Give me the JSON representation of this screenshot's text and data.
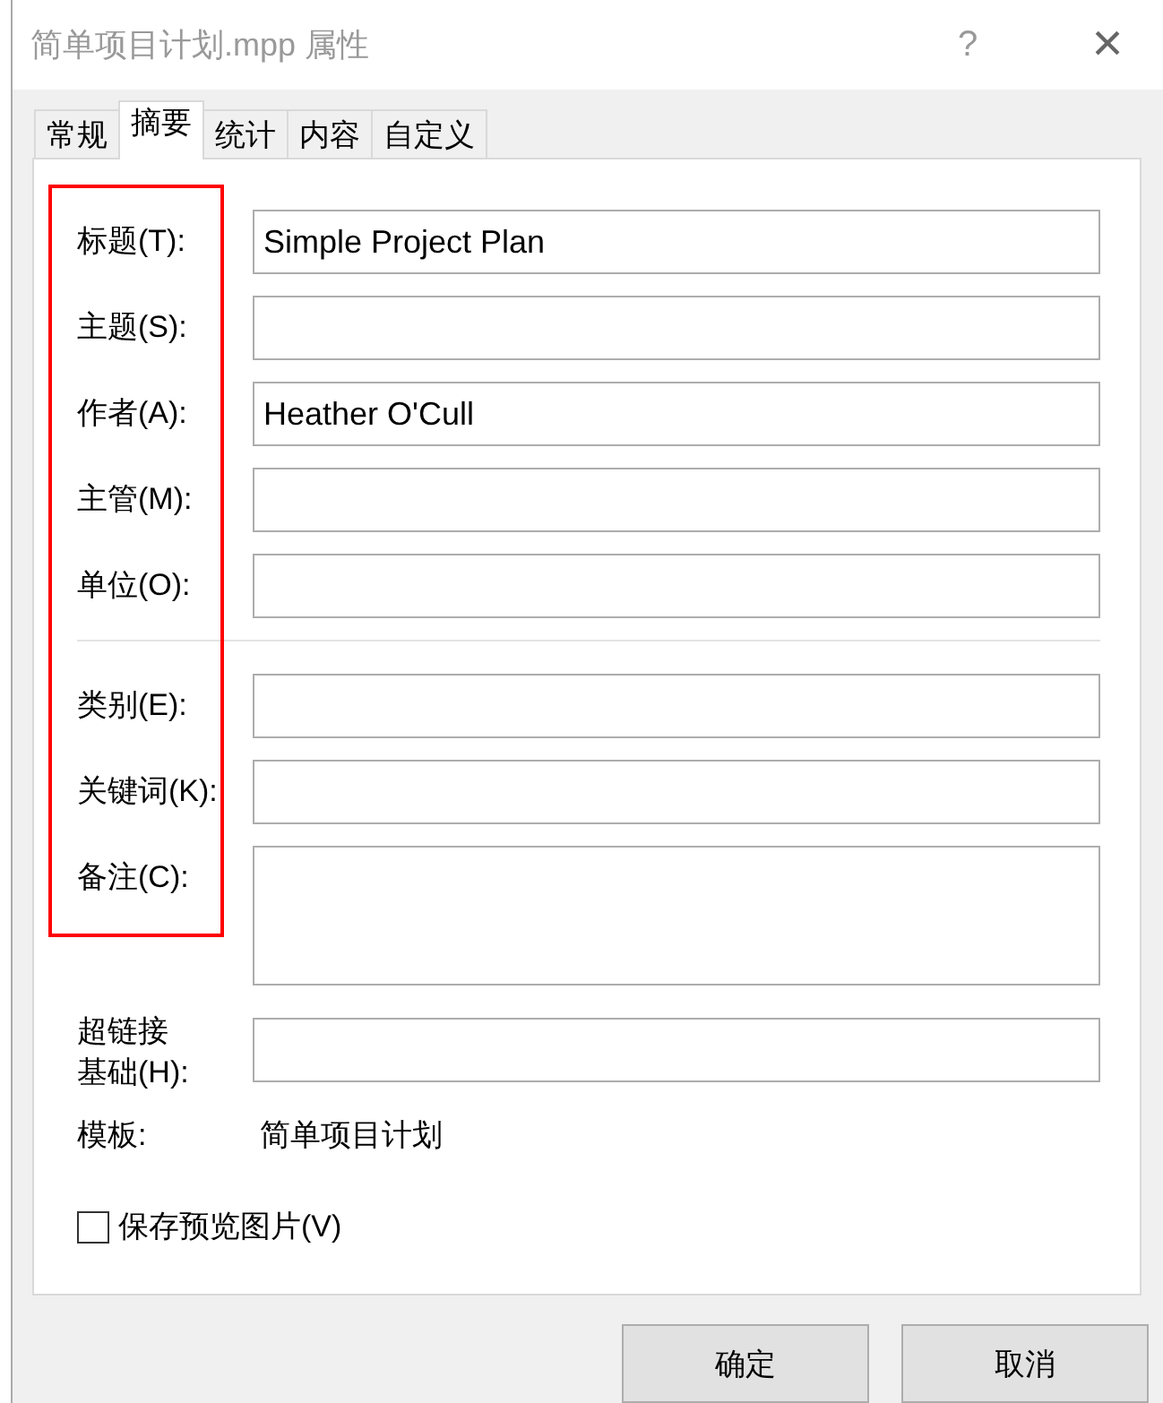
{
  "window": {
    "title": "简单项目计划.mpp 属性",
    "help": "?",
    "close": "×"
  },
  "tabs": [
    {
      "label": "常规",
      "selected": false
    },
    {
      "label": "摘要",
      "selected": true
    },
    {
      "label": "统计",
      "selected": false
    },
    {
      "label": "内容",
      "selected": false
    },
    {
      "label": "自定义",
      "selected": false
    }
  ],
  "sections": [
    [
      {
        "label": "标题(T):",
        "kind": "line",
        "value": "Simple Project Plan"
      },
      {
        "label": "主题(S):",
        "kind": "line"
      },
      {
        "label": "作者(A):",
        "kind": "line",
        "value": "Heather O'Cull"
      },
      {
        "label": "主管(M):",
        "kind": "line"
      },
      {
        "label": "单位(O):",
        "kind": "line"
      }
    ],
    [
      {
        "label": "类别(E):",
        "kind": "line"
      },
      {
        "label": "关键词(K):",
        "kind": "line"
      },
      {
        "label": "备注(C):",
        "kind": "multiline"
      }
    ],
    [
      {
        "label": "超链接基础(H):",
        "kind": "line"
      }
    ]
  ],
  "template": {
    "label": "模板:",
    "value": "简单项目计划"
  },
  "save_preview": {
    "label": "保存预览图片(V)",
    "checked": false
  },
  "highlight_labels": true,
  "buttons": [
    "确定",
    "取消"
  ]
}
